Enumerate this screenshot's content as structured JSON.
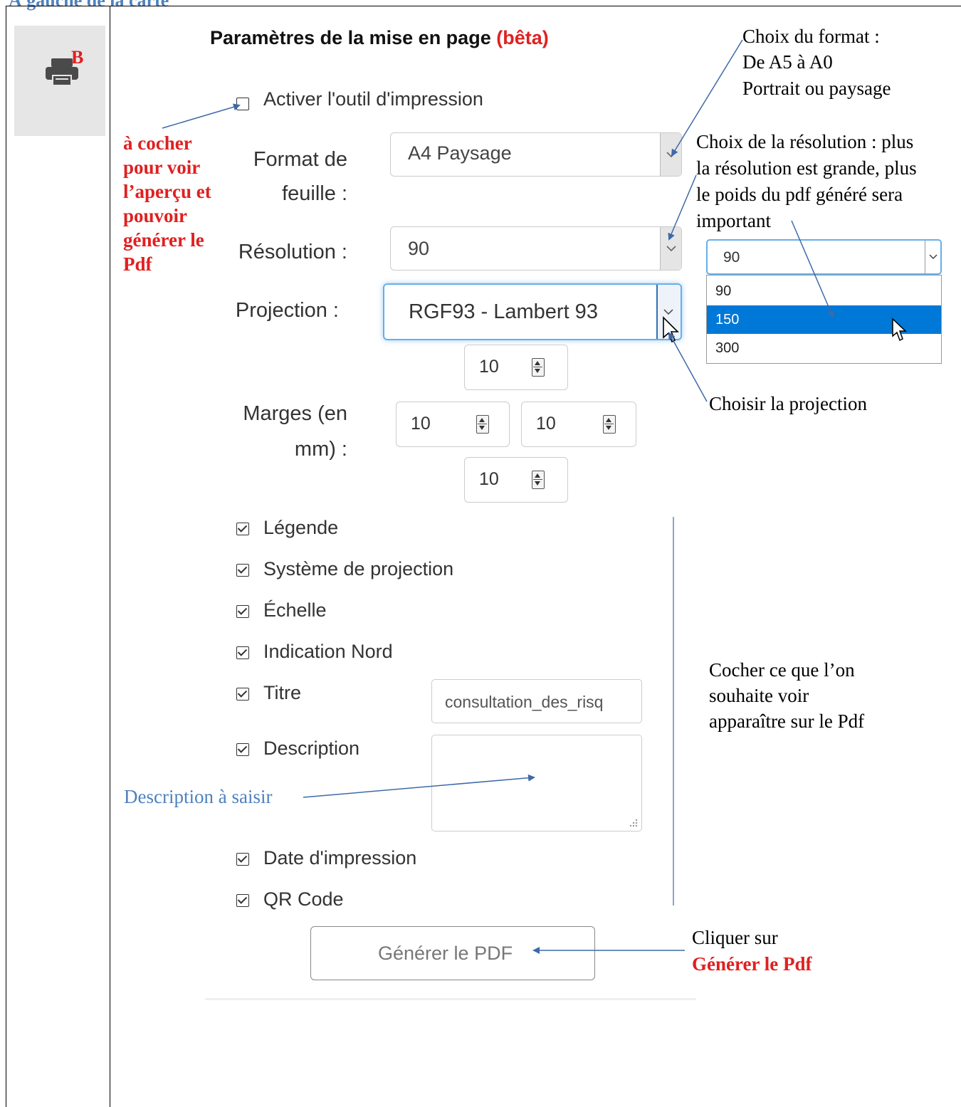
{
  "document": {
    "section_heading": "À gauche de la carte"
  },
  "toolbar": {
    "print_tool_superscript": "B"
  },
  "panel": {
    "title_main": "Paramètres de la mise en page ",
    "title_beta": "(bêta)",
    "activate_label": "Activer l'outil d'impression",
    "format_label": "Format de feuille :",
    "format_value": "A4 Paysage",
    "resolution_label": "Résolution :",
    "resolution_value": "90",
    "projection_label": "Projection :",
    "projection_value": "RGF93 - Lambert 93",
    "margins_label": "Marges (en mm) :",
    "margins": {
      "top": "10",
      "left": "10",
      "right": "10",
      "bottom": "10"
    },
    "options": [
      {
        "label": "Légende",
        "checked": true
      },
      {
        "label": "Système de projection",
        "checked": true
      },
      {
        "label": "Échelle",
        "checked": true
      },
      {
        "label": "Indication Nord",
        "checked": true
      },
      {
        "label": "Titre",
        "checked": true
      },
      {
        "label": "Description",
        "checked": true
      },
      {
        "label": "Date d'impression",
        "checked": true
      },
      {
        "label": "QR Code",
        "checked": true
      }
    ],
    "title_input_value": "consultation_des_risq",
    "description_value": "",
    "generate_button": "Générer le PDF"
  },
  "resolution_dropdown": {
    "current": "90",
    "options": [
      "90",
      "150",
      "300"
    ],
    "highlighted": "150"
  },
  "annotations": {
    "checkbox_hint": "à cocher pour voir l’aperçu et pouvoir générer le Pdf",
    "format_hint_1": "Choix du format :",
    "format_hint_2": "De A5 à A0",
    "format_hint_3": "Portrait ou paysage",
    "resolution_hint_1": "Choix de la résolution : plus",
    "resolution_hint_2": "la résolution est grande, plus",
    "resolution_hint_3": "le poids du pdf généré sera",
    "resolution_hint_4": "important",
    "projection_hint": "Choisir la projection",
    "options_hint_1": "Cocher ce que l’on",
    "options_hint_2": "souhaite voir",
    "options_hint_3": "apparaître sur le Pdf",
    "description_hint": "Description à saisir",
    "generate_hint_1": "Cliquer sur",
    "generate_hint_2": "Générer le Pdf"
  },
  "colors": {
    "annotation_red": "#e02020",
    "heading_blue": "#4f81bd",
    "arrow_blue": "#3d6aa8",
    "selection_blue": "#0078d7",
    "focus_blue": "#66afe9"
  }
}
